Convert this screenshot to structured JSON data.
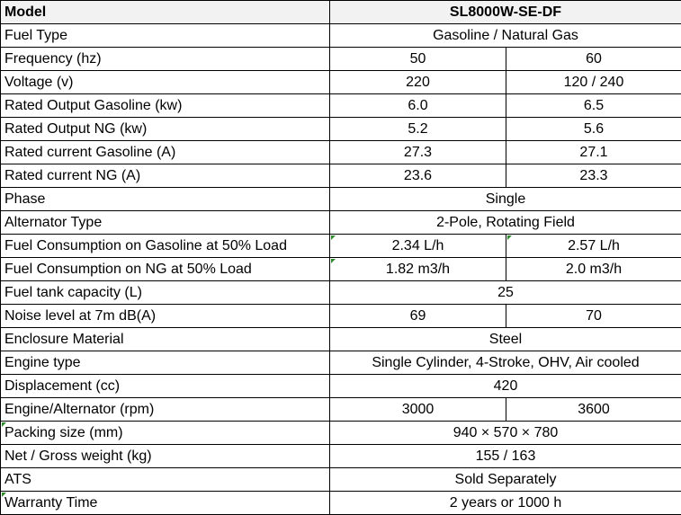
{
  "header": {
    "label": "Model",
    "model": "SL8000W-SE-DF"
  },
  "rows": [
    {
      "label": "Fuel Type",
      "value": "Gasoline / Natural Gas"
    },
    {
      "label": "Frequency  (hz)",
      "v50": "50",
      "v60": "60"
    },
    {
      "label": "Voltage (v)",
      "v50": "220",
      "v60": "120 / 240"
    },
    {
      "label": "Rated Output Gasoline (kw)",
      "v50": "6.0",
      "v60": "6.5"
    },
    {
      "label": "Rated Output NG (kw)",
      "v50": "5.2",
      "v60": "5.6"
    },
    {
      "label": "Rated current  Gasoline (A)",
      "v50": "27.3",
      "v60": "27.1"
    },
    {
      "label": "Rated current NG (A)",
      "v50": "23.6",
      "v60": "23.3"
    },
    {
      "label": "Phase",
      "value": "Single"
    },
    {
      "label": "Alternator Type",
      "value": "2-Pole, Rotating Field"
    },
    {
      "label": "Fuel Consumption on Gasoline at 50% Load",
      "v50": "2.34 L/h",
      "v60": "2.57 L/h"
    },
    {
      "label": "Fuel Consumption on NG at 50% Load",
      "v50": "1.82 m3/h",
      "v60": "2.0 m3/h"
    },
    {
      "label": "Fuel tank capacity (L)",
      "value": "25"
    },
    {
      "label": "Noise level at 7m  dB(A)",
      "v50": "69",
      "v60": "70"
    },
    {
      "label": "Enclosure Material",
      "value": "Steel"
    },
    {
      "label": "Engine type",
      "value": "Single Cylinder, 4-Stroke, OHV, Air cooled"
    },
    {
      "label": "Displacement (cc)",
      "value": "420"
    },
    {
      "label": "Engine/Alternator (rpm)",
      "v50": "3000",
      "v60": "3600"
    },
    {
      "label": "Packing size (mm)",
      "value": "940  × 570 × 780"
    },
    {
      "label": "Net / Gross weight (kg)",
      "value": "155 / 163"
    },
    {
      "label": "ATS",
      "value": "Sold Separately"
    },
    {
      "label": "Warranty Time",
      "value": "2 years or 1000 h"
    }
  ],
  "colors": {
    "header_bg": "#f2f2f2",
    "border": "#000000",
    "cell_marker": "#2e8b2e"
  }
}
